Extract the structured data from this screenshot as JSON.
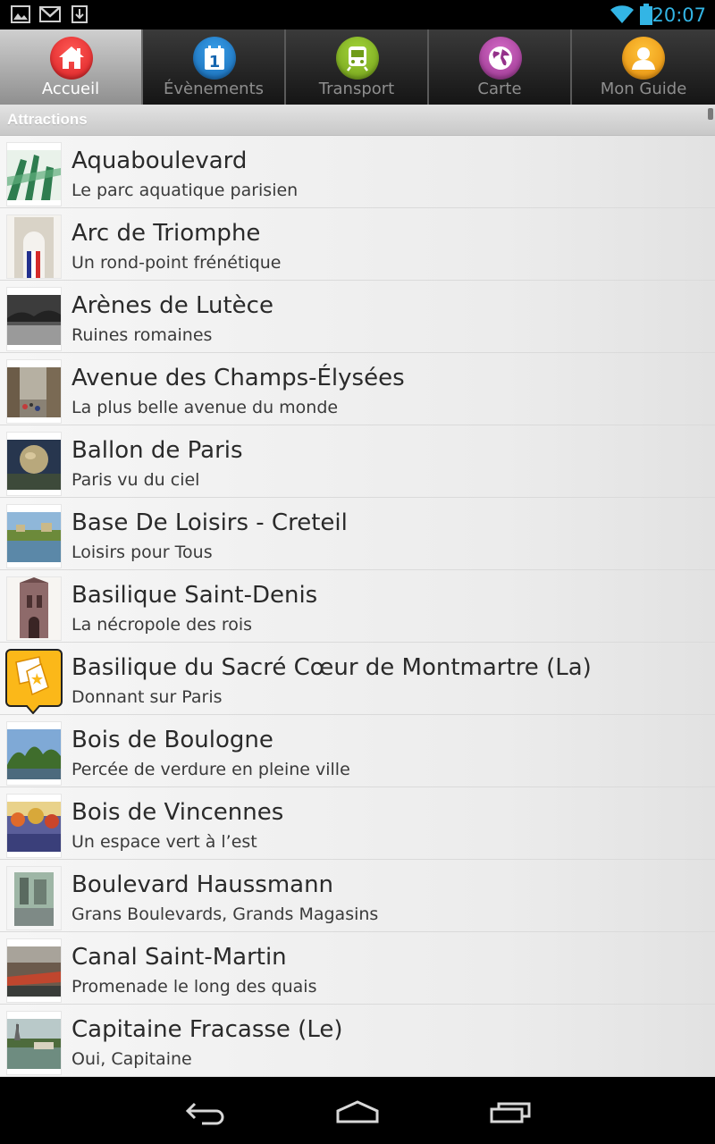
{
  "status_bar": {
    "time": "20:07",
    "icons": [
      "gallery-icon",
      "gmail-icon",
      "download-icon",
      "wifi-icon",
      "battery-icon"
    ],
    "accent_color": "#33b5e5"
  },
  "tabs": [
    {
      "label": "Accueil",
      "icon": "home-icon",
      "color": "#e8252b",
      "active": true
    },
    {
      "label": "Évènements",
      "icon": "calendar-icon",
      "color": "#1f84d0",
      "active": false
    },
    {
      "label": "Transport",
      "icon": "train-icon",
      "color": "#86b82a",
      "active": false
    },
    {
      "label": "Carte",
      "icon": "globe-icon",
      "color": "#b646a8",
      "active": false
    },
    {
      "label": "Mon Guide",
      "icon": "user-icon",
      "color": "#f0a81a",
      "active": false
    }
  ],
  "section": {
    "title": "Attractions"
  },
  "items": [
    {
      "title": "Aquaboulevard",
      "subtitle": "Le parc aquatique parisien"
    },
    {
      "title": "Arc de Triomphe",
      "subtitle": "Un rond-point frénétique"
    },
    {
      "title": "Arènes de Lutèce",
      "subtitle": "Ruines romaines"
    },
    {
      "title": "Avenue des Champs-Élysées",
      "subtitle": "La plus belle avenue du monde"
    },
    {
      "title": "Ballon de Paris",
      "subtitle": "Paris vu du ciel"
    },
    {
      "title": "Base De Loisirs - Creteil",
      "subtitle": "Loisirs pour Tous"
    },
    {
      "title": "Basilique Saint-Denis",
      "subtitle": "La nécropole des rois"
    },
    {
      "title": "Basilique du Sacré Cœur de Montmartre (La)",
      "subtitle": "Donnant sur Paris"
    },
    {
      "title": "Bois de Boulogne",
      "subtitle": "Percée de verdure en pleine ville"
    },
    {
      "title": "Bois de Vincennes",
      "subtitle": "Un espace vert à l’est"
    },
    {
      "title": "Boulevard Haussmann",
      "subtitle": "Grans Boulevards, Grands Magasins"
    },
    {
      "title": "Canal Saint-Martin",
      "subtitle": "Promenade le long des quais"
    },
    {
      "title": "Capitaine Fracasse (Le)",
      "subtitle": "Oui, Capitaine"
    }
  ],
  "nav": [
    "back-icon",
    "home-icon",
    "recent-apps-icon"
  ]
}
